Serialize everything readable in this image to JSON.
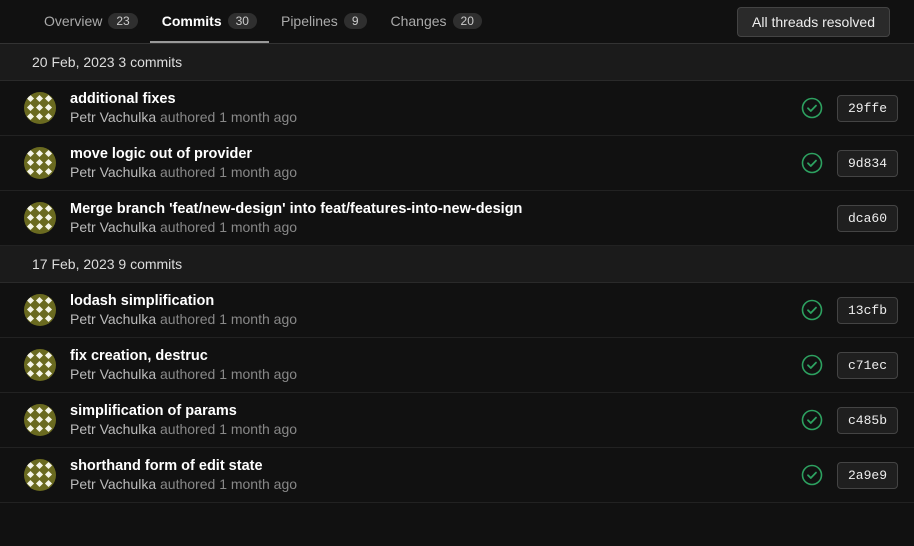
{
  "tabs": [
    {
      "label": "Overview",
      "count": "23",
      "active": false
    },
    {
      "label": "Commits",
      "count": "30",
      "active": true
    },
    {
      "label": "Pipelines",
      "count": "9",
      "active": false
    },
    {
      "label": "Changes",
      "count": "20",
      "active": false
    }
  ],
  "resolve_button": "All threads resolved",
  "author": "Petr Vachulka",
  "authored_word": "authored",
  "time": "1 month ago",
  "groups": [
    {
      "header": "20 Feb, 2023 3 commits",
      "commits": [
        {
          "title": "additional fixes",
          "status": "success",
          "hash": "29ffe"
        },
        {
          "title": "move logic out of provider",
          "status": "success",
          "hash": "9d834"
        },
        {
          "title": "Merge branch 'feat/new-design' into feat/features-into-new-design",
          "status": "none",
          "hash": "dca60"
        }
      ]
    },
    {
      "header": "17 Feb, 2023 9 commits",
      "commits": [
        {
          "title": "lodash simplification",
          "status": "success",
          "hash": "13cfb"
        },
        {
          "title": "fix creation, destruc",
          "status": "success",
          "hash": "c71ec"
        },
        {
          "title": "simplification of params",
          "status": "success",
          "hash": "c485b"
        },
        {
          "title": "shorthand form of edit state",
          "status": "success",
          "hash": "2a9e9"
        }
      ]
    }
  ]
}
